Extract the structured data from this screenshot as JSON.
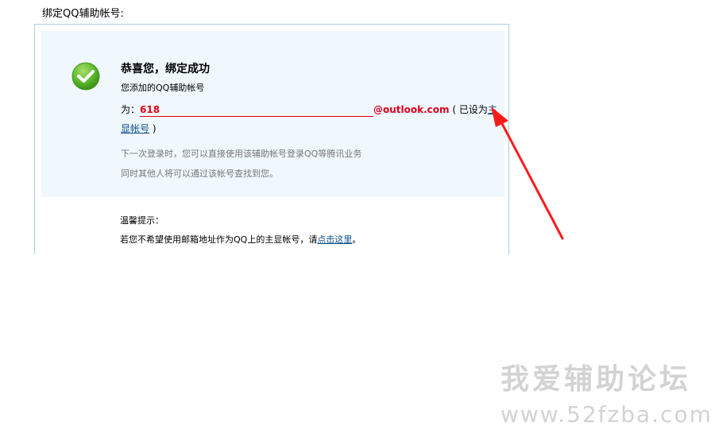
{
  "page": {
    "heading": "绑定QQ辅助帐号:"
  },
  "success": {
    "title": "恭喜您，绑定成功",
    "added_text": "您添加的QQ辅助帐号",
    "prefix": "为：",
    "email_local": "618",
    "email_domain": "@outlook.com",
    "set_as_pre": "( 已设为",
    "primary_link": "主显帐号",
    "set_as_post": ")",
    "info_line_1": "下一次登录时，您可以直接使用该辅助帐号登录QQ等腾讯业务",
    "info_line_2": "同时其他人将可以通过该帐号查找到您。"
  },
  "tip": {
    "title": "温馨提示：",
    "text_before": "若您不希望使用邮箱地址作为QQ上的主显帐号，请",
    "link": "点击这里",
    "text_after": "。"
  },
  "watermark": {
    "title": "我爱辅助论坛",
    "url": "www.52fzba.com"
  },
  "colors": {
    "accent_red": "#e0001b",
    "link_blue": "#0b4f8c",
    "panel_border": "#a9cde6",
    "success_bg": "#f0f8fd",
    "check_green": "#5cb82c",
    "arrow_red": "#ff1a1a"
  }
}
